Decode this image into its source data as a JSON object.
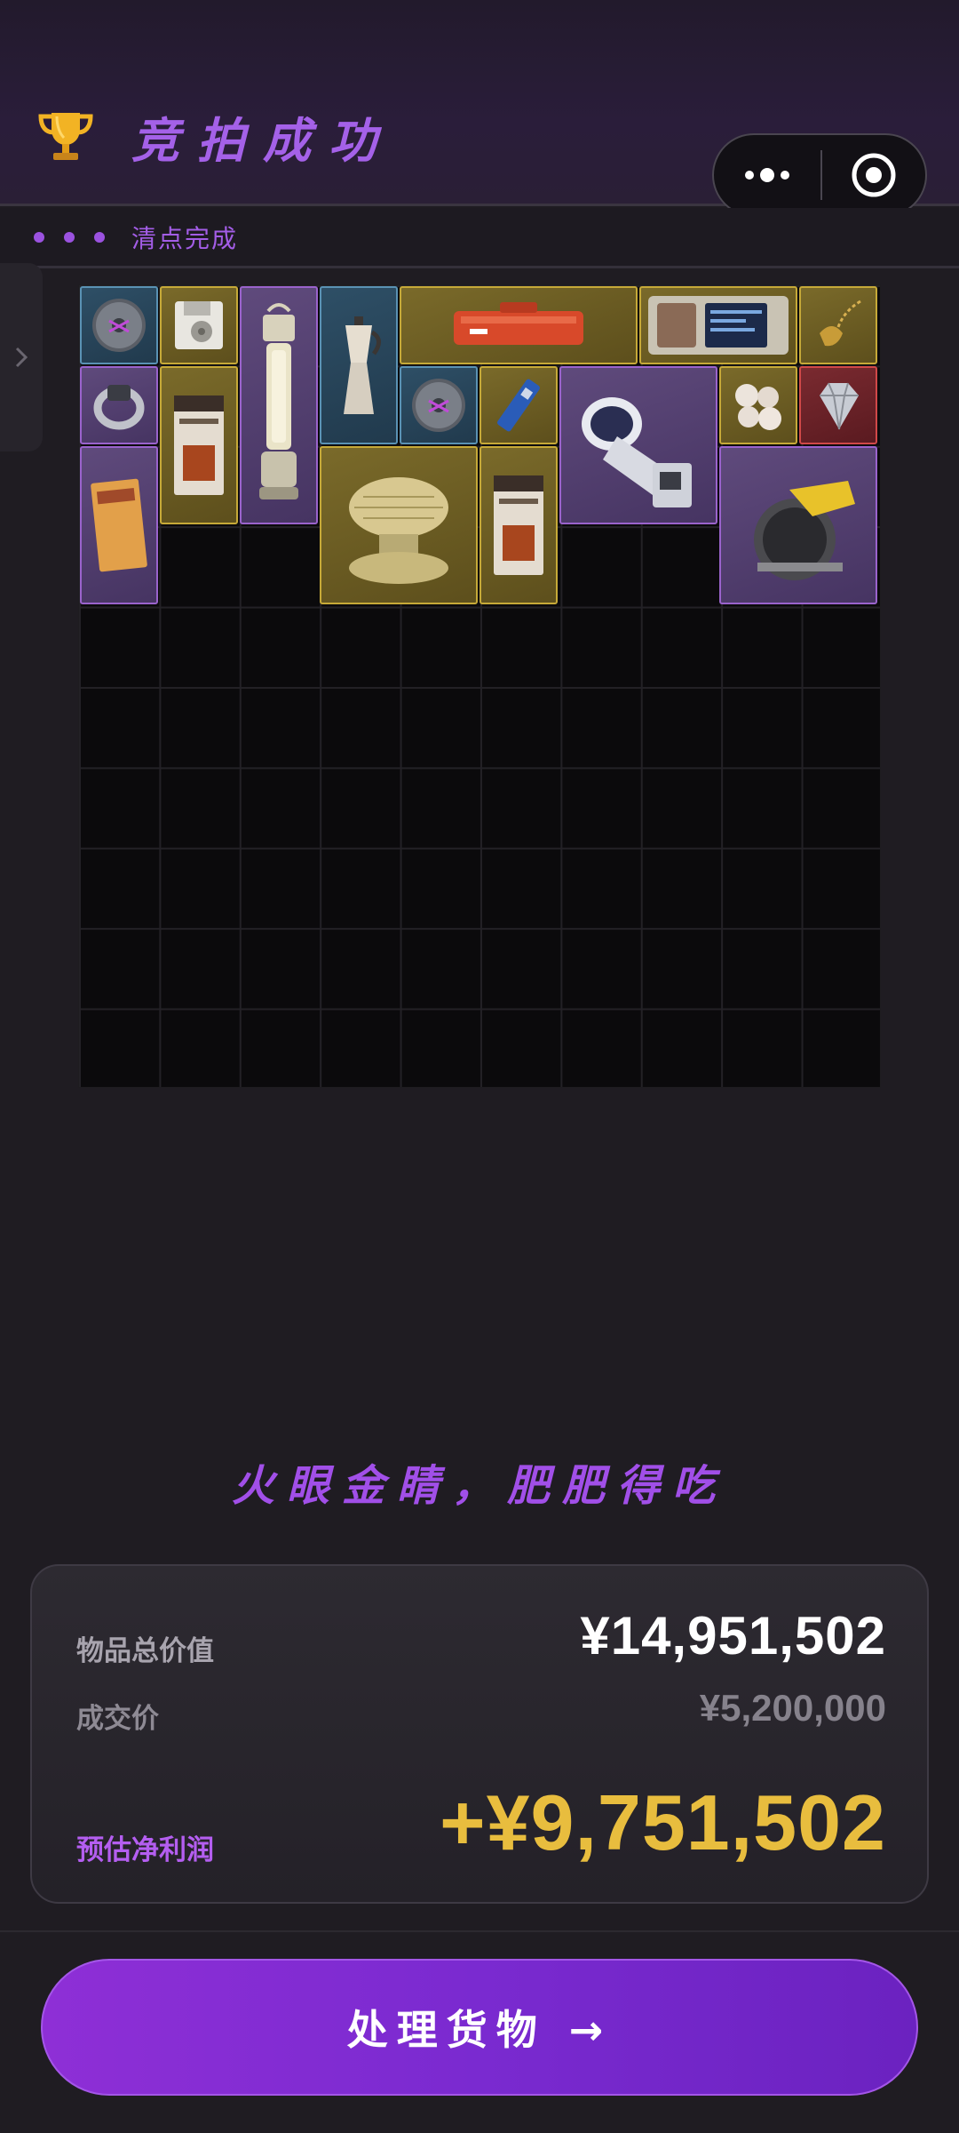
{
  "header": {
    "title": "竞拍成功",
    "trophy_icon": "trophy-icon",
    "menu_more_icon": "more-dots-icon",
    "menu_close_icon": "target-close-icon"
  },
  "status": {
    "text": "清点完成",
    "dots": 3
  },
  "inventory": {
    "columns": 10,
    "rows": 10,
    "items": [
      {
        "name": "hard-drive-disc",
        "rarity": "blue"
      },
      {
        "name": "floppy-disk",
        "rarity": "gold"
      },
      {
        "name": "lantern",
        "rarity": "purple"
      },
      {
        "name": "moka-pot",
        "rarity": "blue"
      },
      {
        "name": "red-tool-case",
        "rarity": "gold"
      },
      {
        "name": "circuit-device",
        "rarity": "gold"
      },
      {
        "name": "gold-skull-pendant",
        "rarity": "gold"
      },
      {
        "name": "ring",
        "rarity": "purple"
      },
      {
        "name": "barista-coffee-box",
        "rarity": "gold"
      },
      {
        "name": "hard-drive-disc-2",
        "rarity": "blue"
      },
      {
        "name": "ssd-stick",
        "rarity": "gold"
      },
      {
        "name": "telescope-part",
        "rarity": "purple"
      },
      {
        "name": "pearls",
        "rarity": "gold"
      },
      {
        "name": "diamond",
        "rarity": "red"
      },
      {
        "name": "black-tide-book",
        "rarity": "purple"
      },
      {
        "name": "golden-wafer-machine",
        "rarity": "gold"
      },
      {
        "name": "barista-coffee-box-2",
        "rarity": "gold"
      },
      {
        "name": "circular-saw",
        "rarity": "purple"
      }
    ]
  },
  "slogan": "火眼金睛，肥肥得吃",
  "summary": {
    "total_label": "物品总价值",
    "total_value": "¥14,951,502",
    "deal_label": "成交价",
    "deal_value": "¥5,200,000",
    "profit_label": "预估净利润",
    "profit_value": "+¥9,751,502"
  },
  "cta": {
    "label": "处理货物 →"
  },
  "colors": {
    "accent_purple": "#a461e8",
    "gold": "#e8bd3e",
    "background": "#1f1c22"
  }
}
